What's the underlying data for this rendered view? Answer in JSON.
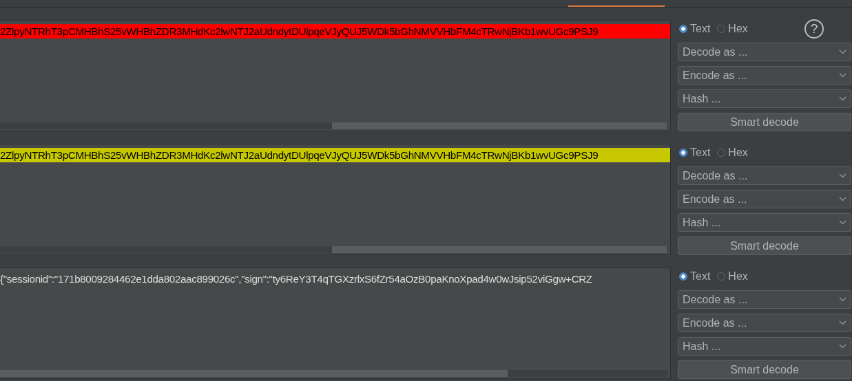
{
  "panels": [
    {
      "text": "2ZlpyNTRhT3pCMHBhS25vWHBhZDR3MHdKc2lwNTJ2aUdndytDUlpqeVJyQUJ5WDk5bGhNMVVHbFM4cTRwNjBKb1wvUGc9PSJ9",
      "color": "#ff0000",
      "formats": [
        {
          "label": "Text",
          "selected": true
        },
        {
          "label": "Hex",
          "selected": false
        }
      ],
      "help": "?",
      "menus": [
        "Decode as ...",
        "Encode as ...",
        "Hash ..."
      ],
      "button": "Smart decode"
    },
    {
      "text": "2ZlpyNTRhT3pCMHBhS25vWHBhZDR3MHdKc2lwNTJ2aUdndytDUlpqeVJyQUJ5WDk5bGhNMVVHbFM4cTRwNjBKb1wvUGc9PSJ9",
      "color": "#c8c800",
      "formats": [
        {
          "label": "Text",
          "selected": true
        },
        {
          "label": "Hex",
          "selected": false
        }
      ],
      "menus": [
        "Decode as ...",
        "Encode as ...",
        "Hash ..."
      ],
      "button": "Smart decode"
    },
    {
      "text": "{\"sessionid\":\"171b8009284462e1dda802aac899026c\",\"sign\":\"ty6ReY3T4qTGXzrlxS6fZr54aOzB0paKnoXpad4w0wJsip52viGgw+CRZ",
      "formats": [
        {
          "label": "Text",
          "selected": true
        },
        {
          "label": "Hex",
          "selected": false
        }
      ],
      "menus": [
        "Decode as ...",
        "Encode as ...",
        "Hash ..."
      ],
      "button": "Smart decode"
    }
  ]
}
